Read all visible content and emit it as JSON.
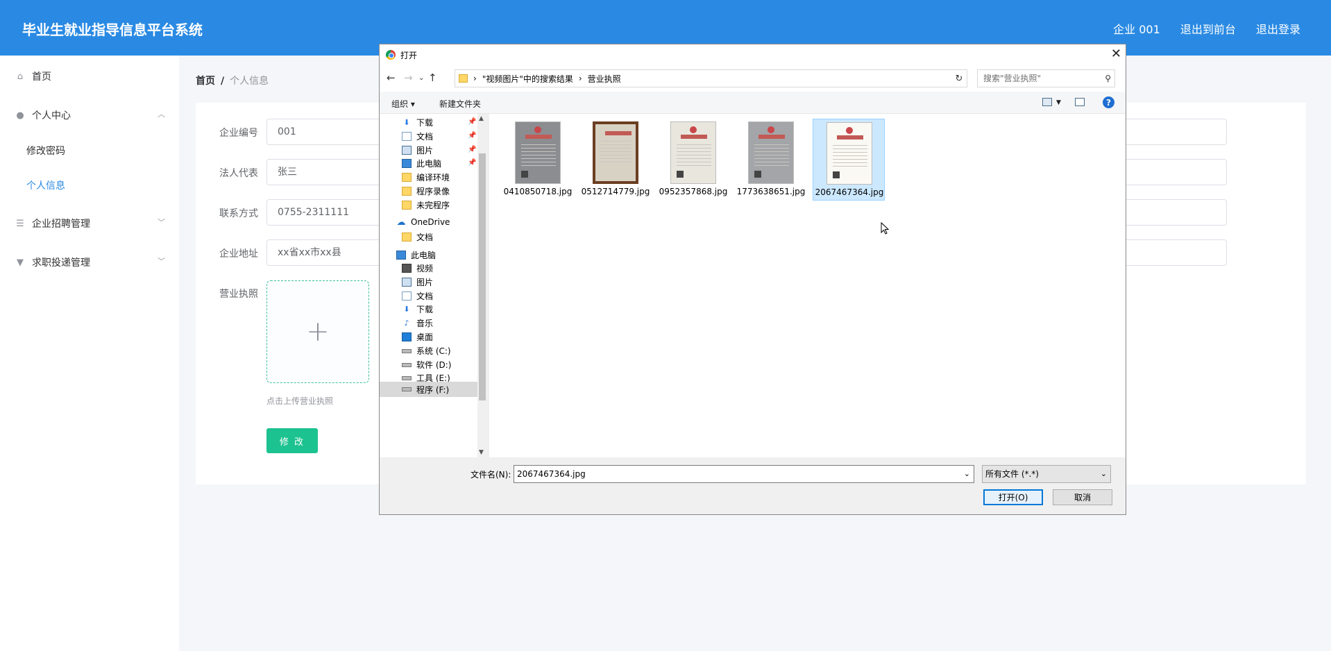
{
  "header": {
    "brand": "毕业生就业指导信息平台系统",
    "nav": [
      "企业 001",
      "退出到前台",
      "退出登录"
    ],
    "bg_color": "#2a8ae3"
  },
  "sidebar": {
    "home": "首页",
    "personal_center": "个人中心",
    "change_password": "修改密码",
    "personal_info": "个人信息",
    "recruit_mgmt": "企业招聘管理",
    "job_apply_mgmt": "求职投递管理"
  },
  "breadcrumb": {
    "home": "首页",
    "sep": "/",
    "current": "个人信息"
  },
  "form": {
    "company_no_label": "企业编号",
    "company_no": "001",
    "legal_rep_label": "法人代表",
    "legal_rep": "张三",
    "contact_label": "联系方式",
    "contact": "0755-2311111",
    "address_label": "企业地址",
    "address": "xx省xx市xx县",
    "license_label": "营业执照",
    "upload_plus": "+",
    "upload_hint": "点击上传营业执照",
    "submit_label": "修 改",
    "accent_color": "#1cc28f"
  },
  "dialog": {
    "title": "打开",
    "path": [
      "\"视频图片\"中的搜索结果",
      "营业执照"
    ],
    "search_placeholder": "搜索\"营业执照\"",
    "organize": "组织 ▾",
    "new_folder": "新建文件夹",
    "help": "?",
    "nav_items": [
      {
        "label": "下载",
        "icon": "download-icon"
      },
      {
        "label": "文档",
        "icon": "document-icon"
      },
      {
        "label": "图片",
        "icon": "picture-icon"
      },
      {
        "label": "此电脑",
        "icon": "computer-icon"
      },
      {
        "label": "编译环境",
        "icon": "folder-icon"
      },
      {
        "label": "程序录像",
        "icon": "folder-icon"
      },
      {
        "label": "未完程序",
        "icon": "folder-icon"
      },
      {
        "label": "OneDrive",
        "icon": "cloud-icon"
      },
      {
        "label": "文档",
        "icon": "folder-icon"
      },
      {
        "label": "此电脑",
        "icon": "computer-icon"
      },
      {
        "label": "视频",
        "icon": "video-icon"
      },
      {
        "label": "图片",
        "icon": "picture-icon"
      },
      {
        "label": "文档",
        "icon": "document-icon"
      },
      {
        "label": "下载",
        "icon": "download-icon"
      },
      {
        "label": "音乐",
        "icon": "music-icon"
      },
      {
        "label": "桌面",
        "icon": "desktop-icon"
      },
      {
        "label": "系统 (C:)",
        "icon": "drive-icon"
      },
      {
        "label": "软件 (D:)",
        "icon": "drive-icon"
      },
      {
        "label": "工具 (E:)",
        "icon": "drive-icon"
      },
      {
        "label": "程序 (F:)",
        "icon": "drive-icon"
      }
    ],
    "files": [
      {
        "name": "0410850718.jpg",
        "selected": false
      },
      {
        "name": "0512714779.jpg",
        "selected": false
      },
      {
        "name": "0952357868.jpg",
        "selected": false
      },
      {
        "name": "1773638651.jpg",
        "selected": false
      },
      {
        "name": "2067467364.jpg",
        "selected": true
      }
    ],
    "filename_label": "文件名(N):",
    "filename_value": "2067467364.jpg",
    "filetype": "所有文件 (*.*)",
    "open_label": "打开(O)",
    "cancel_label": "取消"
  }
}
